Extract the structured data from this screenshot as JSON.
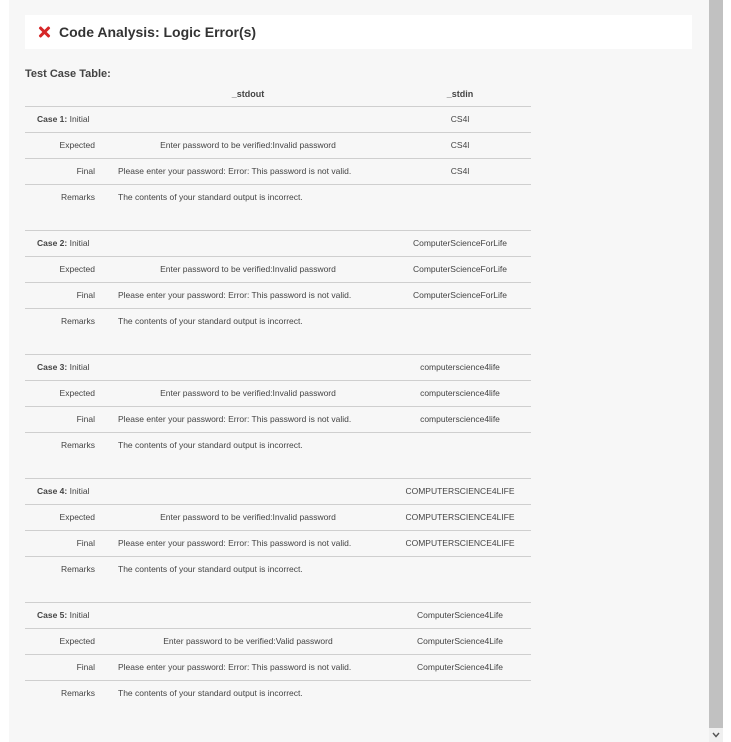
{
  "header": {
    "title": "Code Analysis: Logic Error(s)",
    "icon": "close-x-icon",
    "icon_color": "#d62728"
  },
  "table": {
    "title": "Test Case Table:",
    "columns": {
      "stdout": "_stdout",
      "stdin": "_stdin"
    },
    "cases": [
      {
        "label": "Case 1:",
        "rows": [
          {
            "label": "Initial",
            "stdout": "",
            "stdin": "CS4l"
          },
          {
            "label": "Expected",
            "stdout": "Enter password to be verified:Invalid password",
            "stdin": "CS4l"
          },
          {
            "label": "Final",
            "stdout": "Please enter your password: Error: This password is not valid.",
            "stdin": "CS4l"
          },
          {
            "label": "Remarks",
            "stdout": "The contents of  your standard output  is incorrect.",
            "stdin": ""
          }
        ]
      },
      {
        "label": "Case 2:",
        "rows": [
          {
            "label": "Initial",
            "stdout": "",
            "stdin": "ComputerScienceForLife"
          },
          {
            "label": "Expected",
            "stdout": "Enter password to be verified:Invalid password",
            "stdin": "ComputerScienceForLife"
          },
          {
            "label": "Final",
            "stdout": "Please enter your password: Error: This password is not valid.",
            "stdin": "ComputerScienceForLife"
          },
          {
            "label": "Remarks",
            "stdout": "The contents of  your standard output  is incorrect.",
            "stdin": ""
          }
        ]
      },
      {
        "label": "Case 3:",
        "rows": [
          {
            "label": "Initial",
            "stdout": "",
            "stdin": "computerscience4life"
          },
          {
            "label": "Expected",
            "stdout": "Enter password to be verified:Invalid password",
            "stdin": "computerscience4life"
          },
          {
            "label": "Final",
            "stdout": "Please enter your password: Error: This password is not valid.",
            "stdin": "computerscience4life"
          },
          {
            "label": "Remarks",
            "stdout": "The contents of  your standard output  is incorrect.",
            "stdin": ""
          }
        ]
      },
      {
        "label": "Case 4:",
        "rows": [
          {
            "label": "Initial",
            "stdout": "",
            "stdin": "COMPUTERSCIENCE4LIFE"
          },
          {
            "label": "Expected",
            "stdout": "Enter password to be verified:Invalid password",
            "stdin": "COMPUTERSCIENCE4LIFE"
          },
          {
            "label": "Final",
            "stdout": "Please enter your password: Error: This password is not valid.",
            "stdin": "COMPUTERSCIENCE4LIFE"
          },
          {
            "label": "Remarks",
            "stdout": "The contents of  your standard output  is incorrect.",
            "stdin": ""
          }
        ]
      },
      {
        "label": "Case 5:",
        "rows": [
          {
            "label": "Initial",
            "stdout": "",
            "stdin": "ComputerScience4Life"
          },
          {
            "label": "Expected",
            "stdout": "Enter password to be verified:Valid password",
            "stdin": "ComputerScience4Life"
          },
          {
            "label": "Final",
            "stdout": "Please enter your password: Error: This password is not valid.",
            "stdin": "ComputerScience4Life"
          },
          {
            "label": "Remarks",
            "stdout": "The contents of  your standard output  is incorrect.",
            "stdin": ""
          }
        ]
      }
    ]
  }
}
